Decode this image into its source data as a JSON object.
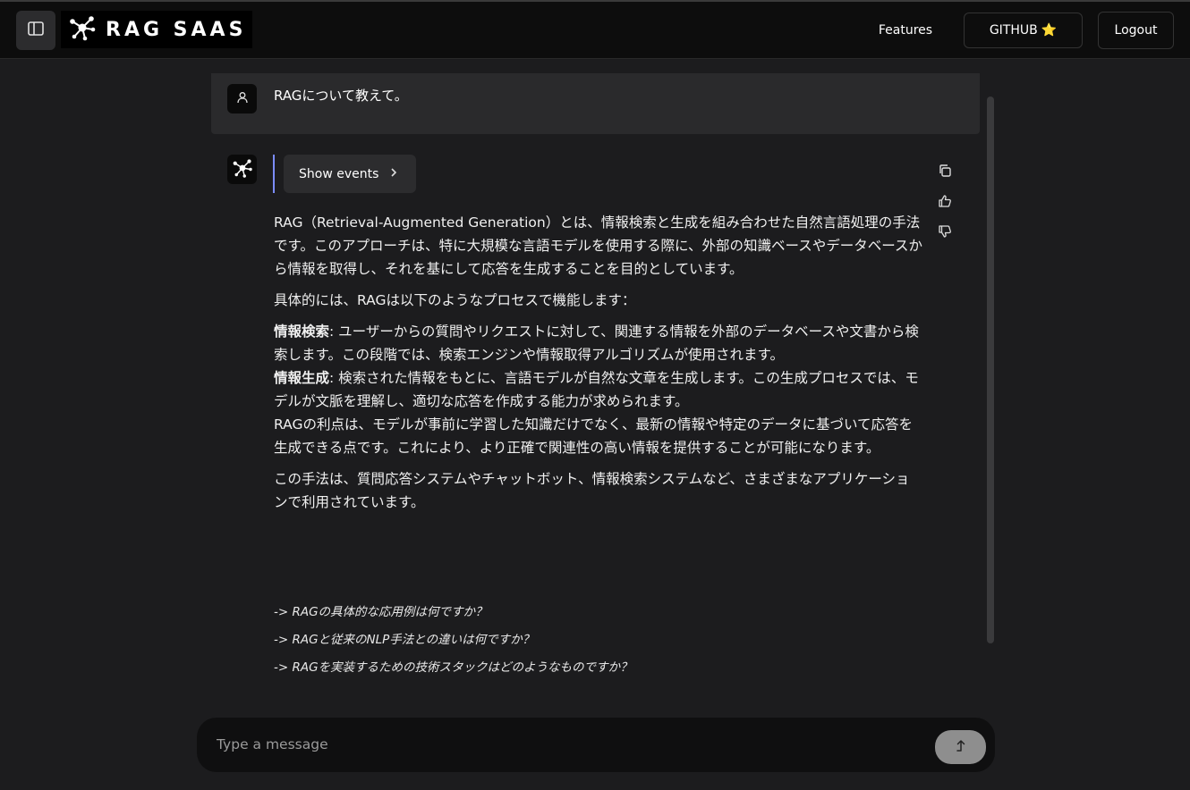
{
  "header": {
    "brand": "RAG SAAS",
    "nav": {
      "features": "Features",
      "github": "GITHUB",
      "github_emoji": "⭐",
      "logout": "Logout"
    }
  },
  "chat": {
    "user_message": "RAGについて教えて。",
    "show_events_label": "Show events",
    "answer": {
      "p1": "RAG（Retrieval-Augmented Generation）とは、情報検索と生成を組み合わせた自然言語処理の手法です。このアプローチは、特に大規模な言語モデルを使用する際に、外部の知識ベースやデータベースから情報を取得し、それを基にして応答を生成することを目的としています。",
      "p2": "具体的には、RAGは以下のようなプロセスで機能します：",
      "item1_title": "情報検索",
      "item1_body": ": ユーザーからの質問やリクエストに対して、関連する情報を外部のデータベースや文書から検索します。この段階では、検索エンジンや情報取得アルゴリズムが使用されます。",
      "item2_title": "情報生成",
      "item2_body": ": 検索された情報をもとに、言語モデルが自然な文章を生成します。この生成プロセスでは、モデルが文脈を理解し、適切な応答を作成する能力が求められます。",
      "p3": "RAGの利点は、モデルが事前に学習した知識だけでなく、最新の情報や特定のデータに基づいて応答を生成できる点です。これにより、より正確で関連性の高い情報を提供することが可能になります。",
      "p4": "この手法は、質問応答システムやチャットボット、情報検索システムなど、さまざまなアプリケーションで利用されています。"
    },
    "followups": [
      "-> RAGの具体的な応用例は何ですか？",
      "-> RAGと従来のNLP手法との違いは何ですか？",
      "-> RAGを実装するための技術スタックはどのようなものですか？"
    ]
  },
  "composer": {
    "placeholder": "Type a message"
  },
  "colors": {
    "background": "#1c1c1e",
    "topbar": "#0d0d0d",
    "accent_bar": "#7b8cff",
    "send_button": "#8e8e8e"
  },
  "icons": {
    "sidebar_toggle": "sidebar-icon",
    "logo": "network-nodes-icon",
    "user_avatar": "user-icon",
    "bot_avatar": "network-nodes-icon",
    "copy": "copy-icon",
    "like": "thumbs-up-icon",
    "dislike": "thumbs-down-icon",
    "send": "arrow-up-icon"
  }
}
